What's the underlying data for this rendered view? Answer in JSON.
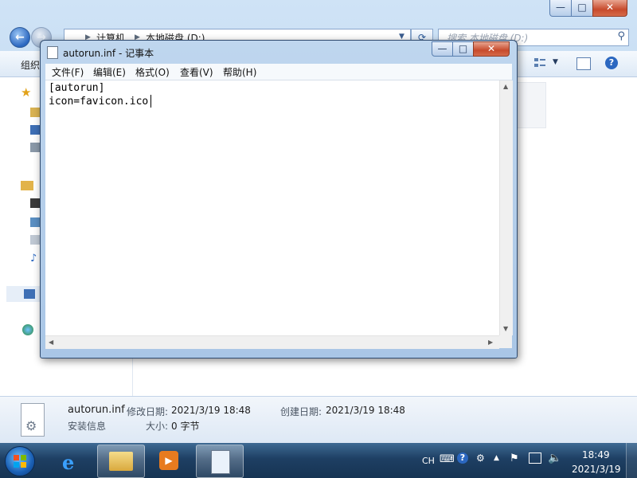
{
  "explorer": {
    "min_label": "—",
    "max_label": "□",
    "close_label": "✕",
    "breadcrumb": [
      "计算机",
      "本地磁盘 (D:)"
    ],
    "breadcrumb_sep": "▶",
    "search_placeholder": "搜索 本地磁盘 (D:)",
    "organize_label": "组织",
    "details": {
      "filename": "autorun.inf",
      "modified_label": "修改日期:",
      "modified_value": "2021/3/19 18:48",
      "created_label": "创建日期:",
      "created_value": "2021/3/19 18:48",
      "type": "安装信息",
      "size_label": "大小:",
      "size_value": "0 字节"
    }
  },
  "notepad": {
    "title": "autorun.inf - 记事本",
    "menu": [
      "文件(F)",
      "编辑(E)",
      "格式(O)",
      "查看(V)",
      "帮助(H)"
    ],
    "content_lines": [
      "[autorun]",
      "icon=favicon.ico"
    ],
    "min_label": "—",
    "max_label": "□",
    "close_label": "✕"
  },
  "taskbar": {
    "ime": "CH",
    "time": "18:49",
    "date": "2021/3/19"
  },
  "colors": {
    "taskbar": "#1e3f63",
    "close_red": "#c74a2c",
    "accent_blue": "#2b67c0"
  }
}
